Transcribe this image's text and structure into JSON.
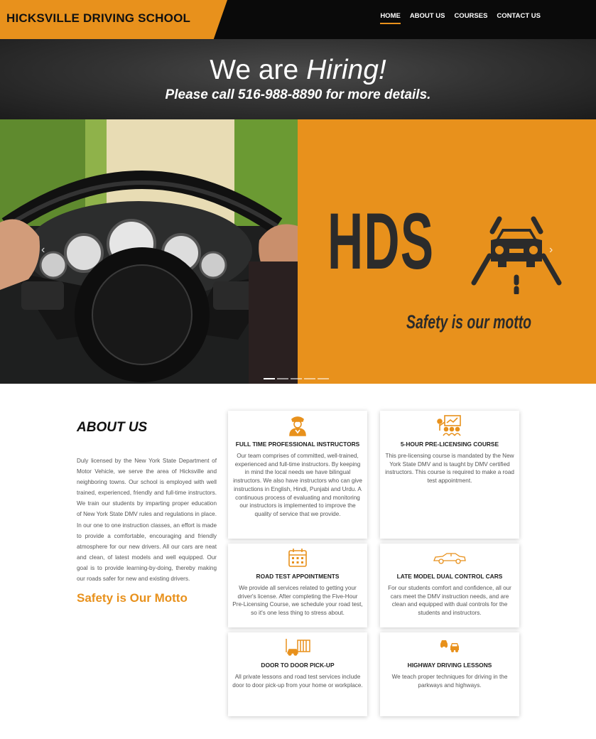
{
  "header": {
    "brand": "HICKSVILLE DRIVING SCHOOL",
    "nav": [
      {
        "label": "HOME"
      },
      {
        "label": "ABOUT US"
      },
      {
        "label": "COURSES"
      },
      {
        "label": "CONTACT US"
      }
    ]
  },
  "hiring": {
    "title_prefix": "We are ",
    "title_emphasis": "Hiring!",
    "subtitle": "Please call 516-988-8890 for more details."
  },
  "hero": {
    "logo_text": "HDS",
    "motto": "Safety is our motto",
    "prev_arrow": "‹",
    "next_arrow": "›",
    "slide_count": 5,
    "active_slide": 1
  },
  "about": {
    "title": "ABOUT US",
    "body": "Duly licensed by the New York State Department of Motor Vehicle, we serve the area of Hicksville and neighboring towns. Our school is employed with well trained, experienced, friendly and full-time instructors. We train our students by imparting proper education of New York State DMV rules and regulations in place. In our one to one instruction classes, an effort is made to provide a comfortable, encouraging and friendly atmosphere for our new drivers. All our cars are neat and clean, of latest models and well equipped. Our goal is to provide learning-by-doing, thereby making our roads safer for new and existing drivers.",
    "motto": "Safety is Our Motto"
  },
  "cards": [
    {
      "icon": "instructor-icon",
      "title": "FULL TIME PROFESSIONAL INSTRUCTORS",
      "text": "Our team comprises of committed, well-trained, experienced and full-time instructors. By keeping in mind the local needs we have bilingual instructors. We also have instructors who can give instructions in English, Hindi, Punjabi and Urdu. A continuous process of evaluating and monitoring our instructors is implemented to improve the quality of service that we provide."
    },
    {
      "icon": "classroom-icon",
      "title": "5-HOUR PRE-LICENSING COURSE",
      "text": "This pre-licensing course is mandated by the New York State DMV and is taught by DMV certified instructors. This course is required to make a road test appointment."
    },
    {
      "icon": "calendar-icon",
      "title": "ROAD TEST APPOINTMENTS",
      "text": "We provide all services related to getting your driver's license. After completing the Five-Hour Pre-Licensing Course, we schedule your road test, so it's one less thing to stress about."
    },
    {
      "icon": "car-icon",
      "title": "LATE MODEL DUAL CONTROL CARS",
      "text": "For our students comfort and confidence, all our cars meet the DMV instruction needs, and are clean and equipped with dual controls for the students and instructors."
    },
    {
      "icon": "pickup-icon",
      "title": "DOOR TO DOOR PICK-UP",
      "text": "All private lessons and road test services include door to door pick-up from your home or workplace."
    },
    {
      "icon": "highway-icon",
      "title": "HIGHWAY DRIVING LESSONS",
      "text": "We teach proper techniques for driving in the parkways and highways."
    }
  ],
  "colors": {
    "accent": "#e8911c",
    "dark": "#0a0a0a"
  }
}
